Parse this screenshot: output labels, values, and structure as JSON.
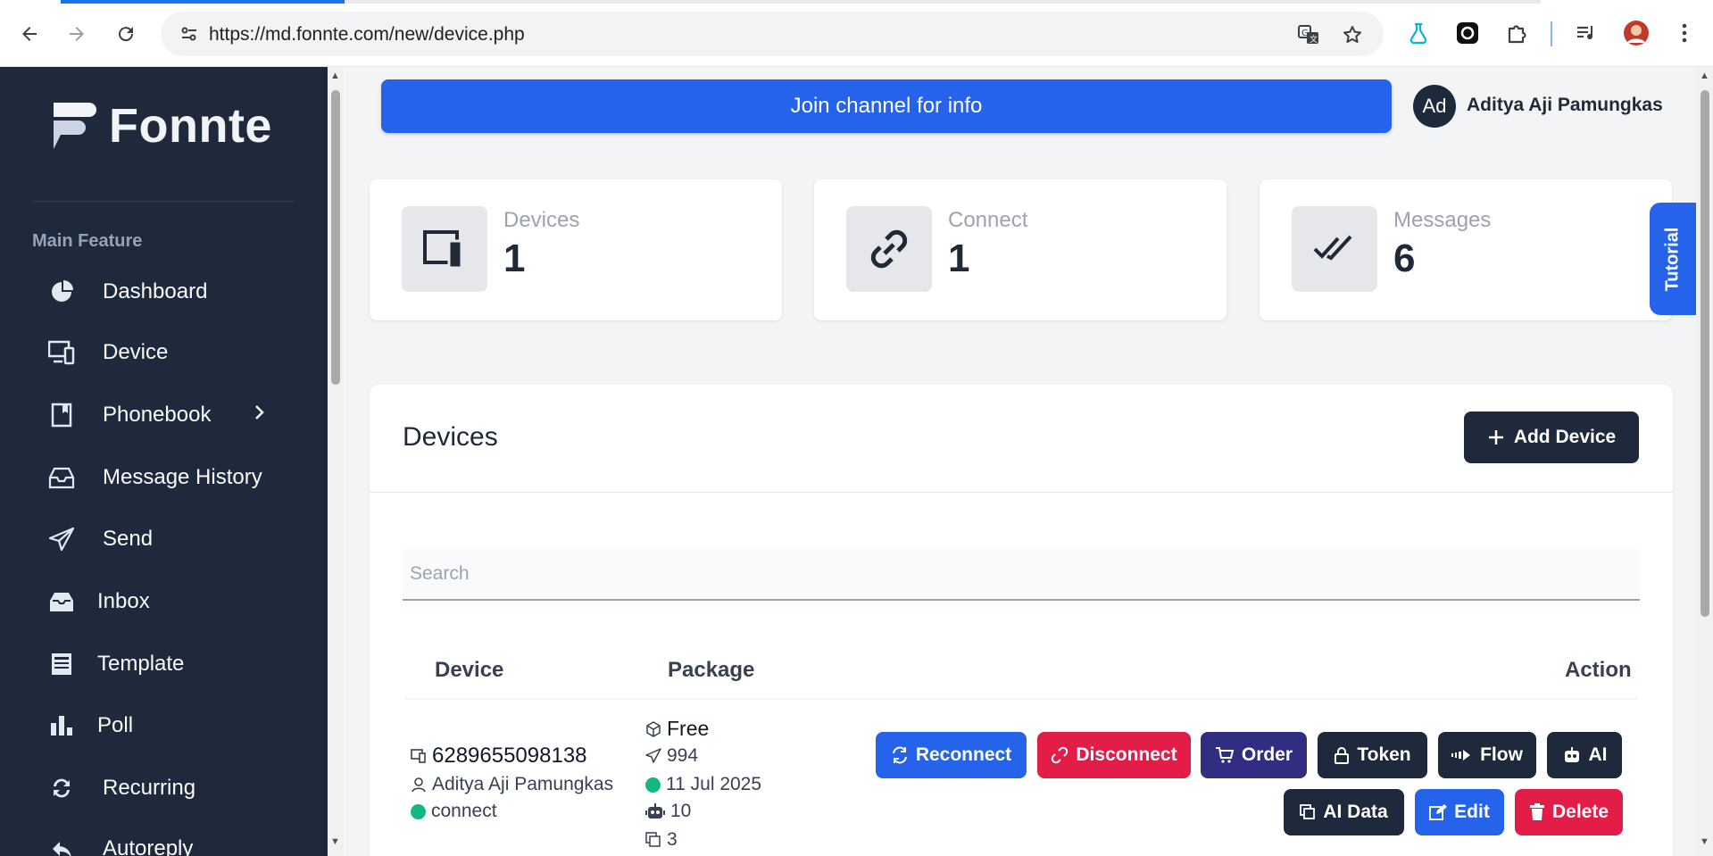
{
  "browser": {
    "url": "https://md.fonnte.com/new/device.php",
    "icons": [
      "back-icon",
      "forward-icon",
      "reload-icon",
      "site-settings-icon",
      "translate-icon",
      "bookmark-star-icon",
      "flask-extension-icon",
      "chatgpt-extension-icon",
      "extensions-puzzle-icon",
      "media-queue-icon",
      "profile-avatar",
      "more-menu-icon"
    ]
  },
  "sidebar": {
    "brand": "Fonnte",
    "section_title": "Main Feature",
    "items": [
      {
        "label": "Dashboard",
        "icon": "pie-chart-icon"
      },
      {
        "label": "Device",
        "icon": "devices-icon"
      },
      {
        "label": "Phonebook",
        "icon": "book-icon"
      },
      {
        "label": "Message History",
        "icon": "inbox-tray-icon"
      },
      {
        "label": "Send",
        "icon": "paper-plane-icon"
      },
      {
        "label": "Inbox",
        "icon": "inbox-icon"
      },
      {
        "label": "Template",
        "icon": "template-icon"
      },
      {
        "label": "Poll",
        "icon": "bar-chart-icon"
      },
      {
        "label": "Recurring",
        "icon": "recurring-icon"
      },
      {
        "label": "Autoreply",
        "icon": "autoreply-icon"
      }
    ]
  },
  "header": {
    "join_label": "Join channel for info",
    "avatar_initials": "Ad",
    "user_name": "Aditya Aji Pamungkas"
  },
  "stats": [
    {
      "label": "Devices",
      "value": "1",
      "icon": "device-icon"
    },
    {
      "label": "Connect",
      "value": "1",
      "icon": "link-icon"
    },
    {
      "label": "Messages",
      "value": "6",
      "icon": "double-check-icon"
    }
  ],
  "tutorial_label": "Tutorial",
  "devices_panel": {
    "title": "Devices",
    "add_label": "Add Device",
    "search_placeholder": "Search",
    "columns": {
      "device": "Device",
      "package": "Package",
      "action": "Action"
    },
    "row": {
      "number": "6289655098138",
      "owner": "Aditya Aji Pamungkas",
      "status": "connect",
      "package": "Free",
      "quota": "994",
      "expiry": "11 Jul 2025",
      "ai_quota": "10",
      "ai_data": "3"
    },
    "actions": {
      "reconnect": "Reconnect",
      "disconnect": "Disconnect",
      "order": "Order",
      "token": "Token",
      "flow": "Flow",
      "ai": "AI",
      "ai_data": "AI Data",
      "edit": "Edit",
      "delete": "Delete"
    }
  },
  "colors": {
    "primary": "#2563eb",
    "danger": "#e11d48",
    "dark": "#1e293b",
    "indigo": "#312e81",
    "success": "#10b981"
  }
}
